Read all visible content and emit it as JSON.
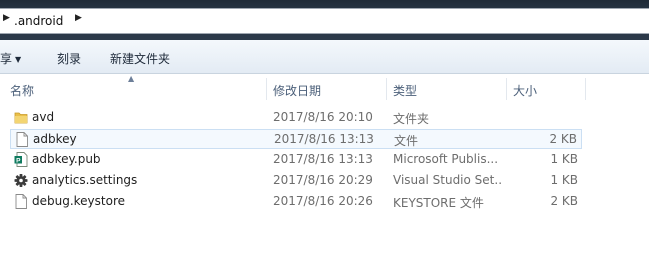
{
  "address": {
    "path": ".android"
  },
  "toolbar": {
    "share_label": "享",
    "record_label": "刻录",
    "new_folder_label": "新建文件夹"
  },
  "columns": {
    "name": "名称",
    "date": "修改日期",
    "type": "类型",
    "size": "大小"
  },
  "files": [
    {
      "name": "avd",
      "date": "2017/8/16 20:10",
      "type": "文件夹",
      "size": "",
      "icon": "folder-icon"
    },
    {
      "name": "adbkey",
      "date": "2017/8/16 13:13",
      "type": "文件",
      "size": "2 KB",
      "icon": "file-icon"
    },
    {
      "name": "adbkey.pub",
      "date": "2017/8/16 13:13",
      "type": "Microsoft Publis...",
      "size": "1 KB",
      "icon": "publisher-file-icon"
    },
    {
      "name": "analytics.settings",
      "date": "2017/8/16 20:29",
      "type": "Visual Studio Set...",
      "size": "1 KB",
      "icon": "settings-gear-icon"
    },
    {
      "name": "debug.keystore",
      "date": "2017/8/16 20:26",
      "type": "KEYSTORE 文件",
      "size": "2 KB",
      "icon": "file-icon"
    }
  ],
  "colors": {
    "folder": "#e9bf4a",
    "selection_border": "#cbdff3",
    "header_text": "#4c607a"
  }
}
